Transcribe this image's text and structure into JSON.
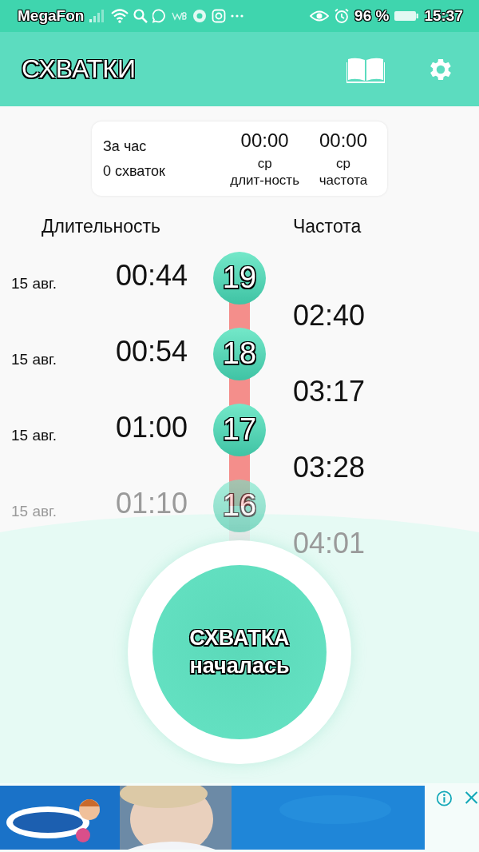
{
  "status_bar": {
    "carrier": "MegaFon",
    "battery_percent": "96 %",
    "time": "15:37"
  },
  "app_bar": {
    "title": "СХВАТКИ"
  },
  "summary": {
    "title": "За час",
    "count": "0 схваток",
    "stats": [
      {
        "value": "00:00",
        "caption": "ср",
        "label": "длит-ность"
      },
      {
        "value": "00:00",
        "caption": "ср",
        "label": "частота"
      }
    ]
  },
  "columns": {
    "duration": "Длительность",
    "frequency": "Частота"
  },
  "contractions": [
    {
      "number": "19",
      "date": "15 авг.",
      "duration": "00:44",
      "faded": false
    },
    {
      "number": "18",
      "date": "15 авг.",
      "duration": "00:54",
      "faded": false
    },
    {
      "number": "17",
      "date": "15 авг.",
      "duration": "01:00",
      "faded": false
    },
    {
      "number": "16",
      "date": "15 авг.",
      "duration": "01:10",
      "faded": true
    }
  ],
  "intervals": [
    {
      "value": "02:40",
      "faded": false
    },
    {
      "value": "03:17",
      "faded": false
    },
    {
      "value": "03:28",
      "faded": false
    },
    {
      "value": "04:01",
      "faded": true
    }
  ],
  "start_button": {
    "line_1": "СХВАТКА",
    "line_2": "началась"
  }
}
